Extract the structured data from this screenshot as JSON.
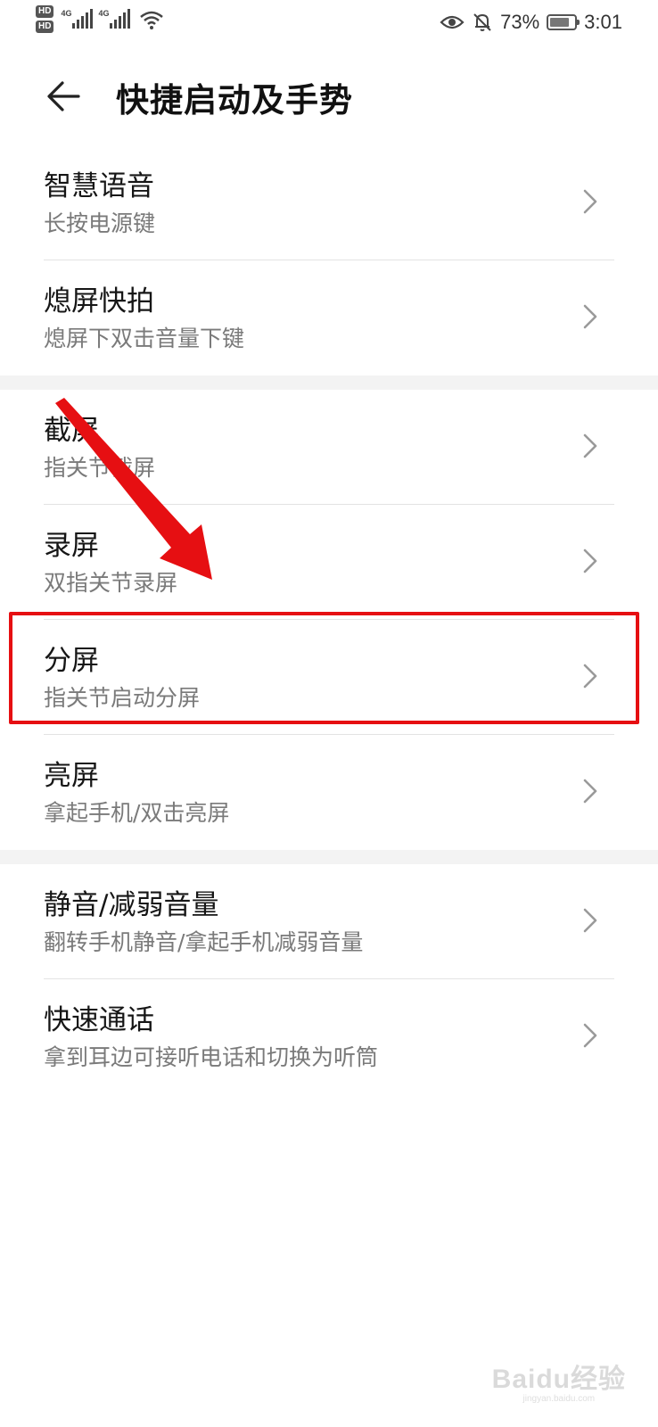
{
  "status_bar": {
    "hd1": "HD",
    "hd2": "HD",
    "net1": "4G",
    "net2": "4G",
    "battery_percent": "73%",
    "time": "3:01",
    "icons": [
      "eye-icon",
      "bell-off-icon",
      "battery-icon",
      "wifi-icon",
      "signal-icon"
    ]
  },
  "header": {
    "title": "快捷启动及手势",
    "back_icon": "back-arrow-icon"
  },
  "groups": [
    {
      "items": [
        {
          "title": "智慧语音",
          "subtitle": "长按电源键"
        },
        {
          "title": "熄屏快拍",
          "subtitle": "熄屏下双击音量下键"
        }
      ]
    },
    {
      "items": [
        {
          "title": "截屏",
          "subtitle": "指关节截屏"
        },
        {
          "title": "录屏",
          "subtitle": "双指关节录屏"
        },
        {
          "title": "分屏",
          "subtitle": "指关节启动分屏"
        },
        {
          "title": "亮屏",
          "subtitle": "拿起手机/双击亮屏"
        }
      ]
    },
    {
      "items": [
        {
          "title": "静音/减弱音量",
          "subtitle": "翻转手机静音/拿起手机减弱音量"
        },
        {
          "title": "快速通话",
          "subtitle": "拿到耳边可接听电话和切换为听筒"
        }
      ]
    }
  ],
  "annotation": {
    "highlighted_item": "分屏",
    "color": "#e60f12"
  },
  "watermark": {
    "main": "Baidu经验",
    "sub": "jingyan.baidu.com"
  }
}
